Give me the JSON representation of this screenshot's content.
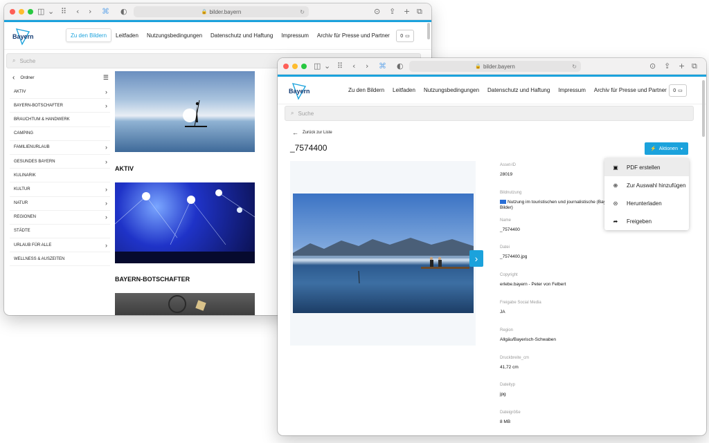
{
  "win1": {
    "url": "bilder.bayern",
    "logo_text": "Bayern",
    "nav": [
      "Zu den Bildern",
      "Leitfaden",
      "Nutzungsbedingungen",
      "Datenschutz und Haftung",
      "Impressum",
      "Archiv für Presse und Partner"
    ],
    "cart_count": "0",
    "search_placeholder": "Suche",
    "sidebar_title": "Ordner",
    "sidebar_items": [
      {
        "label": "Aktiv",
        "chev": true
      },
      {
        "label": "Bayern-Botschafter",
        "chev": true
      },
      {
        "label": "Brauchtum & Handwerk",
        "chev": false
      },
      {
        "label": "Camping",
        "chev": false
      },
      {
        "label": "Familienurlaub",
        "chev": true
      },
      {
        "label": "Gesundes Bayern",
        "chev": true
      },
      {
        "label": "Kulinarik",
        "chev": false
      },
      {
        "label": "Kultur",
        "chev": true
      },
      {
        "label": "Natur",
        "chev": true
      },
      {
        "label": "Regionen",
        "chev": true
      },
      {
        "label": "Städte",
        "chev": false
      },
      {
        "label": "Urlaub für alle",
        "chev": true
      },
      {
        "label": "Wellness & Auszeiten",
        "chev": false
      }
    ],
    "categories": [
      "AKTIV",
      "BAYERN-BOTSCHAFTER"
    ]
  },
  "win2": {
    "url": "bilder.bayern",
    "logo_text": "Bayern",
    "nav": [
      "Zu den Bildern",
      "Leitfaden",
      "Nutzungsbedingungen",
      "Datenschutz und Haftung",
      "Impressum",
      "Archiv für Presse und Partner"
    ],
    "cart_count": "0",
    "search_placeholder": "Suche",
    "back_label": "Zurück zur Liste",
    "asset_title": "_7574400",
    "actions_label": "Aktionen",
    "dropdown": [
      {
        "label": "PDF erstellen",
        "icon": "file-pdf-icon",
        "glyph": "▣"
      },
      {
        "label": "Zur Auswahl hinzufügen",
        "icon": "plus-circle-icon",
        "glyph": "⊕"
      },
      {
        "label": "Herunterladen",
        "icon": "download-circle-icon",
        "glyph": "⊝"
      },
      {
        "label": "Freigeben",
        "icon": "share-icon",
        "glyph": "➦"
      }
    ],
    "meta": [
      {
        "label": "Asset-ID",
        "value": "28019"
      },
      {
        "label": "Bildnutzung",
        "value": "Nutzung im touristischen und journalistische (BayTM-Bilder)",
        "flag": true
      },
      {
        "label": "Name",
        "value": "_7574400"
      },
      {
        "label": "Datei",
        "value": "_7574400.jpg"
      },
      {
        "label": "Copyright",
        "value": "erlebe.bayern - Peter von Felbert"
      },
      {
        "label": "Freigabe Social Media",
        "value": "JA"
      },
      {
        "label": "Region",
        "value": "Allgäu/Bayerisch-Schwaben"
      },
      {
        "label": "Druckbreite_cm",
        "value": "41,72 cm"
      },
      {
        "label": "Dateityp",
        "value": "jpg"
      },
      {
        "label": "Dateigröße",
        "value": "8 MB"
      }
    ]
  },
  "colors": {
    "accent": "#1ba2dc",
    "logo": "#123a72"
  }
}
